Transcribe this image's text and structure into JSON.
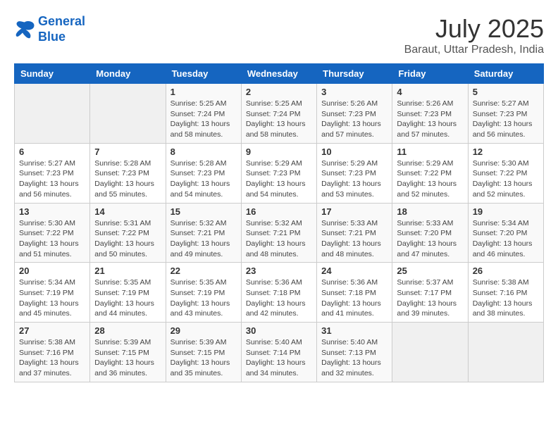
{
  "header": {
    "logo_line1": "General",
    "logo_line2": "Blue",
    "month": "July 2025",
    "location": "Baraut, Uttar Pradesh, India"
  },
  "weekdays": [
    "Sunday",
    "Monday",
    "Tuesday",
    "Wednesday",
    "Thursday",
    "Friday",
    "Saturday"
  ],
  "weeks": [
    [
      {
        "day": "",
        "info": ""
      },
      {
        "day": "",
        "info": ""
      },
      {
        "day": "1",
        "info": "Sunrise: 5:25 AM\nSunset: 7:24 PM\nDaylight: 13 hours\nand 58 minutes."
      },
      {
        "day": "2",
        "info": "Sunrise: 5:25 AM\nSunset: 7:24 PM\nDaylight: 13 hours\nand 58 minutes."
      },
      {
        "day": "3",
        "info": "Sunrise: 5:26 AM\nSunset: 7:23 PM\nDaylight: 13 hours\nand 57 minutes."
      },
      {
        "day": "4",
        "info": "Sunrise: 5:26 AM\nSunset: 7:23 PM\nDaylight: 13 hours\nand 57 minutes."
      },
      {
        "day": "5",
        "info": "Sunrise: 5:27 AM\nSunset: 7:23 PM\nDaylight: 13 hours\nand 56 minutes."
      }
    ],
    [
      {
        "day": "6",
        "info": "Sunrise: 5:27 AM\nSunset: 7:23 PM\nDaylight: 13 hours\nand 56 minutes."
      },
      {
        "day": "7",
        "info": "Sunrise: 5:28 AM\nSunset: 7:23 PM\nDaylight: 13 hours\nand 55 minutes."
      },
      {
        "day": "8",
        "info": "Sunrise: 5:28 AM\nSunset: 7:23 PM\nDaylight: 13 hours\nand 54 minutes."
      },
      {
        "day": "9",
        "info": "Sunrise: 5:29 AM\nSunset: 7:23 PM\nDaylight: 13 hours\nand 54 minutes."
      },
      {
        "day": "10",
        "info": "Sunrise: 5:29 AM\nSunset: 7:23 PM\nDaylight: 13 hours\nand 53 minutes."
      },
      {
        "day": "11",
        "info": "Sunrise: 5:29 AM\nSunset: 7:22 PM\nDaylight: 13 hours\nand 52 minutes."
      },
      {
        "day": "12",
        "info": "Sunrise: 5:30 AM\nSunset: 7:22 PM\nDaylight: 13 hours\nand 52 minutes."
      }
    ],
    [
      {
        "day": "13",
        "info": "Sunrise: 5:30 AM\nSunset: 7:22 PM\nDaylight: 13 hours\nand 51 minutes."
      },
      {
        "day": "14",
        "info": "Sunrise: 5:31 AM\nSunset: 7:22 PM\nDaylight: 13 hours\nand 50 minutes."
      },
      {
        "day": "15",
        "info": "Sunrise: 5:32 AM\nSunset: 7:21 PM\nDaylight: 13 hours\nand 49 minutes."
      },
      {
        "day": "16",
        "info": "Sunrise: 5:32 AM\nSunset: 7:21 PM\nDaylight: 13 hours\nand 48 minutes."
      },
      {
        "day": "17",
        "info": "Sunrise: 5:33 AM\nSunset: 7:21 PM\nDaylight: 13 hours\nand 48 minutes."
      },
      {
        "day": "18",
        "info": "Sunrise: 5:33 AM\nSunset: 7:20 PM\nDaylight: 13 hours\nand 47 minutes."
      },
      {
        "day": "19",
        "info": "Sunrise: 5:34 AM\nSunset: 7:20 PM\nDaylight: 13 hours\nand 46 minutes."
      }
    ],
    [
      {
        "day": "20",
        "info": "Sunrise: 5:34 AM\nSunset: 7:19 PM\nDaylight: 13 hours\nand 45 minutes."
      },
      {
        "day": "21",
        "info": "Sunrise: 5:35 AM\nSunset: 7:19 PM\nDaylight: 13 hours\nand 44 minutes."
      },
      {
        "day": "22",
        "info": "Sunrise: 5:35 AM\nSunset: 7:19 PM\nDaylight: 13 hours\nand 43 minutes."
      },
      {
        "day": "23",
        "info": "Sunrise: 5:36 AM\nSunset: 7:18 PM\nDaylight: 13 hours\nand 42 minutes."
      },
      {
        "day": "24",
        "info": "Sunrise: 5:36 AM\nSunset: 7:18 PM\nDaylight: 13 hours\nand 41 minutes."
      },
      {
        "day": "25",
        "info": "Sunrise: 5:37 AM\nSunset: 7:17 PM\nDaylight: 13 hours\nand 39 minutes."
      },
      {
        "day": "26",
        "info": "Sunrise: 5:38 AM\nSunset: 7:16 PM\nDaylight: 13 hours\nand 38 minutes."
      }
    ],
    [
      {
        "day": "27",
        "info": "Sunrise: 5:38 AM\nSunset: 7:16 PM\nDaylight: 13 hours\nand 37 minutes."
      },
      {
        "day": "28",
        "info": "Sunrise: 5:39 AM\nSunset: 7:15 PM\nDaylight: 13 hours\nand 36 minutes."
      },
      {
        "day": "29",
        "info": "Sunrise: 5:39 AM\nSunset: 7:15 PM\nDaylight: 13 hours\nand 35 minutes."
      },
      {
        "day": "30",
        "info": "Sunrise: 5:40 AM\nSunset: 7:14 PM\nDaylight: 13 hours\nand 34 minutes."
      },
      {
        "day": "31",
        "info": "Sunrise: 5:40 AM\nSunset: 7:13 PM\nDaylight: 13 hours\nand 32 minutes."
      },
      {
        "day": "",
        "info": ""
      },
      {
        "day": "",
        "info": ""
      }
    ]
  ]
}
